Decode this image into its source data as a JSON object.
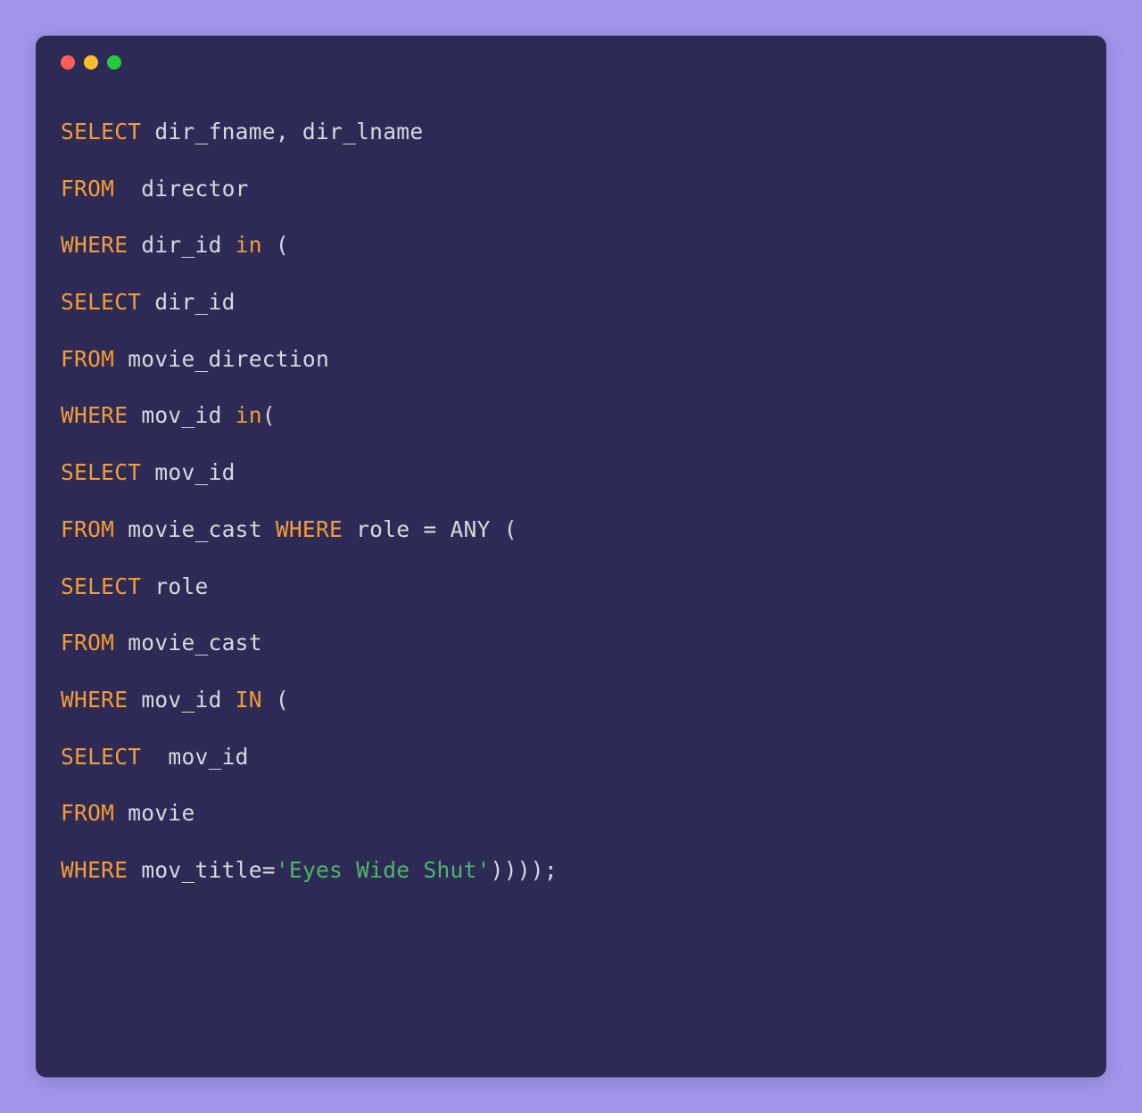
{
  "window": {
    "traffic_lights": [
      "red",
      "yellow",
      "green"
    ]
  },
  "colors": {
    "background": "#a294eb",
    "terminal_bg": "#2d2b55",
    "keyword": "#f39c39",
    "identifier": "#d8d8e0",
    "string": "#4fb56d",
    "red": "#ff5f56",
    "yellow": "#ffbd2e",
    "green": "#27c93f"
  },
  "code": {
    "lines": [
      [
        {
          "text": "SELECT",
          "class": "keyword"
        },
        {
          "text": " dir_fname, dir_lname",
          "class": "identifier"
        }
      ],
      [
        {
          "text": "FROM",
          "class": "keyword"
        },
        {
          "text": "  director",
          "class": "identifier"
        }
      ],
      [
        {
          "text": "WHERE",
          "class": "keyword"
        },
        {
          "text": " dir_id ",
          "class": "identifier"
        },
        {
          "text": "in",
          "class": "keyword"
        },
        {
          "text": " (",
          "class": "paren"
        }
      ],
      [
        {
          "text": "SELECT",
          "class": "keyword"
        },
        {
          "text": " dir_id",
          "class": "identifier"
        }
      ],
      [
        {
          "text": "FROM",
          "class": "keyword"
        },
        {
          "text": " movie_direction",
          "class": "identifier"
        }
      ],
      [
        {
          "text": "WHERE",
          "class": "keyword"
        },
        {
          "text": " mov_id ",
          "class": "identifier"
        },
        {
          "text": "in",
          "class": "keyword"
        },
        {
          "text": "(",
          "class": "paren"
        }
      ],
      [
        {
          "text": "SELECT",
          "class": "keyword"
        },
        {
          "text": " mov_id",
          "class": "identifier"
        }
      ],
      [
        {
          "text": "FROM",
          "class": "keyword"
        },
        {
          "text": " movie_cast ",
          "class": "identifier"
        },
        {
          "text": "WHERE",
          "class": "keyword"
        },
        {
          "text": " role ",
          "class": "identifier"
        },
        {
          "text": "=",
          "class": "operator"
        },
        {
          "text": " ANY (",
          "class": "identifier"
        }
      ],
      [
        {
          "text": "SELECT",
          "class": "keyword"
        },
        {
          "text": " role",
          "class": "identifier"
        }
      ],
      [
        {
          "text": "FROM",
          "class": "keyword"
        },
        {
          "text": " movie_cast",
          "class": "identifier"
        }
      ],
      [
        {
          "text": "WHERE",
          "class": "keyword"
        },
        {
          "text": " mov_id ",
          "class": "identifier"
        },
        {
          "text": "IN",
          "class": "keyword"
        },
        {
          "text": " (",
          "class": "paren"
        }
      ],
      [
        {
          "text": "SELECT",
          "class": "keyword"
        },
        {
          "text": "  mov_id",
          "class": "identifier"
        }
      ],
      [
        {
          "text": "FROM",
          "class": "keyword"
        },
        {
          "text": " movie",
          "class": "identifier"
        }
      ],
      [
        {
          "text": "WHERE",
          "class": "keyword"
        },
        {
          "text": " mov_title",
          "class": "identifier"
        },
        {
          "text": "=",
          "class": "operator"
        },
        {
          "text": "'Eyes Wide Shut'",
          "class": "string"
        },
        {
          "text": "))));",
          "class": "paren"
        }
      ]
    ]
  }
}
